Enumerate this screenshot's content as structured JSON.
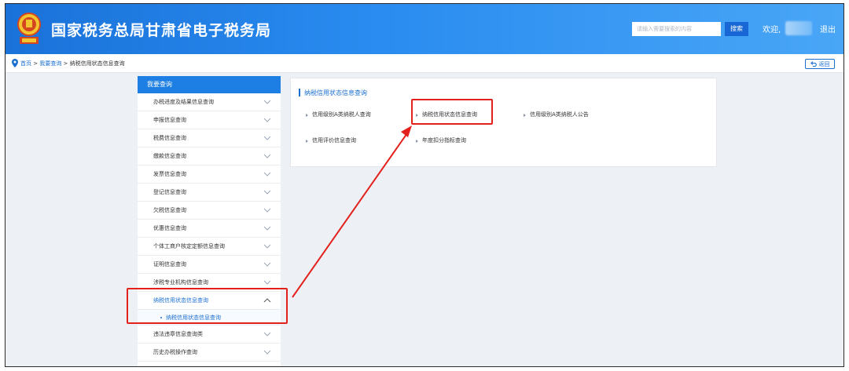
{
  "header": {
    "site_title": "国家税务总局甘肃省电子税务局",
    "search_placeholder": "请输入需要搜索的内容",
    "search_button": "搜索",
    "welcome": "欢迎,",
    "logout": "退出",
    "emblem_icon": "tax-emblem-icon"
  },
  "breadcrumb": {
    "home": "首页",
    "sep1": " > ",
    "level1": "我要查询",
    "sep2": " > ",
    "current": "纳税信用状态信息查询",
    "back": "返回"
  },
  "sidebar": {
    "heading": "我要查询",
    "items": [
      {
        "label": "办税进度及结果信息查询"
      },
      {
        "label": "申报信息查询"
      },
      {
        "label": "税费信息查询"
      },
      {
        "label": "缴款信息查询"
      },
      {
        "label": "发票信息查询"
      },
      {
        "label": "登记信息查询"
      },
      {
        "label": "欠税信息查询"
      },
      {
        "label": "优惠信息查询"
      },
      {
        "label": "个体工商户核定定额信息查询"
      },
      {
        "label": "证明信息查询"
      },
      {
        "label": "涉税专业机构信息查询"
      },
      {
        "label": "纳税信用状态信息查询"
      },
      {
        "label": "违法违章信息查询类"
      },
      {
        "label": "历史办税操作查询"
      }
    ],
    "active_sub": "纳税信用状态信息查询"
  },
  "panel": {
    "title": "纳税信用状态信息查询",
    "links": [
      {
        "label": "信用级别A类纳税人查询"
      },
      {
        "label": "纳税信用状态信息查询"
      },
      {
        "label": "信用级别A类纳税人公告"
      },
      {
        "label": "信用评价信息查询"
      },
      {
        "label": "年度扣分指标查询"
      }
    ]
  },
  "colors": {
    "header_blue": "#1a72d9",
    "link_blue": "#1a6fd1",
    "highlight_red": "#e3211c"
  }
}
